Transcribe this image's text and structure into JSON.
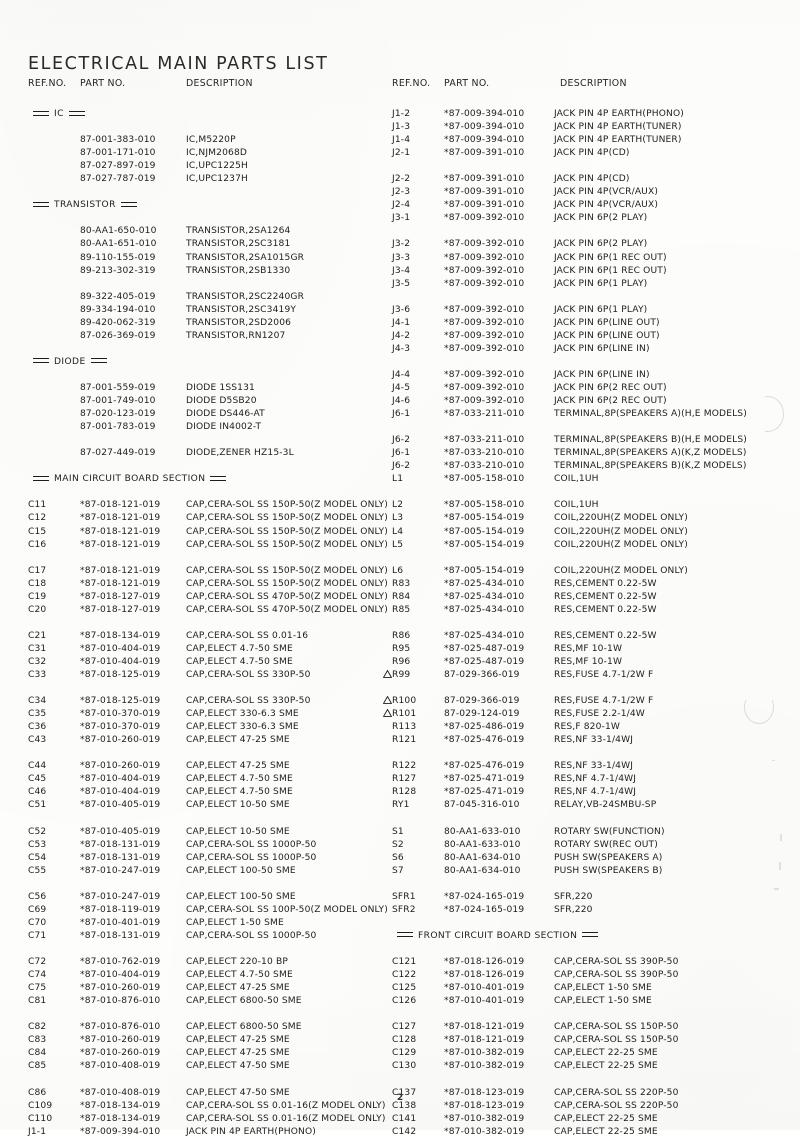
{
  "document": {
    "title": "ELECTRICAL  MAIN  PARTS  LIST",
    "page_number": "2"
  },
  "columns": {
    "ref_no": "REF.NO.",
    "part_no": "PART NO.",
    "description": "DESCRIPTION"
  },
  "sections": {
    "ic": "IC",
    "transistor": "TRANSISTOR",
    "diode": "DIODE",
    "main_circuit_board": "MAIN CIRCUIT BOARD SECTION",
    "front_circuit_board": "FRONT CIRCUIT BOARD SECTION"
  },
  "left_column": [
    {
      "type": "section",
      "label": "IC"
    },
    {
      "type": "blank"
    },
    {
      "type": "item",
      "ref": "",
      "part": "87-001-383-010",
      "desc": "IC,M5220P"
    },
    {
      "type": "item",
      "ref": "",
      "part": "87-001-171-010",
      "desc": "IC,NJM2068D"
    },
    {
      "type": "item",
      "ref": "",
      "part": "87-027-897-019",
      "desc": "IC,UPC1225H"
    },
    {
      "type": "item",
      "ref": "",
      "part": "87-027-787-019",
      "desc": "IC,UPC1237H"
    },
    {
      "type": "blank"
    },
    {
      "type": "section",
      "label": "TRANSISTOR"
    },
    {
      "type": "blank"
    },
    {
      "type": "item",
      "ref": "",
      "part": "80-AA1-650-010",
      "desc": "TRANSISTOR,2SA1264"
    },
    {
      "type": "item",
      "ref": "",
      "part": "80-AA1-651-010",
      "desc": "TRANSISTOR,2SC3181"
    },
    {
      "type": "item",
      "ref": "",
      "part": "89-110-155-019",
      "desc": "TRANSISTOR,2SA1015GR"
    },
    {
      "type": "item",
      "ref": "",
      "part": "89-213-302-319",
      "desc": "TRANSISTOR,2SB1330"
    },
    {
      "type": "blank"
    },
    {
      "type": "item",
      "ref": "",
      "part": "89-322-405-019",
      "desc": "TRANSISTOR,2SC2240GR"
    },
    {
      "type": "item",
      "ref": "",
      "part": "89-334-194-010",
      "desc": "TRANSISTOR,2SC3419Y"
    },
    {
      "type": "item",
      "ref": "",
      "part": "89-420-062-319",
      "desc": "TRANSISTOR,2SD2006"
    },
    {
      "type": "item",
      "ref": "",
      "part": "87-026-369-019",
      "desc": "TRANSISTOR,RN1207"
    },
    {
      "type": "blank"
    },
    {
      "type": "section",
      "label": "DIODE"
    },
    {
      "type": "blank"
    },
    {
      "type": "item",
      "ref": "",
      "part": "87-001-559-019",
      "desc": "DIODE 1SS131"
    },
    {
      "type": "item",
      "ref": "",
      "part": "87-001-749-010",
      "desc": "DIODE D5SB20"
    },
    {
      "type": "item",
      "ref": "",
      "part": "87-020-123-019",
      "desc": "DIODE DS446-AT"
    },
    {
      "type": "item",
      "ref": "",
      "part": "87-001-783-019",
      "desc": "DIODE IN4002-T"
    },
    {
      "type": "blank"
    },
    {
      "type": "item",
      "ref": "",
      "part": "87-027-449-019",
      "desc": "DIODE,ZENER HZ15-3L"
    },
    {
      "type": "blank"
    },
    {
      "type": "section",
      "label": "MAIN CIRCUIT BOARD SECTION"
    },
    {
      "type": "blank"
    },
    {
      "type": "item",
      "ref": "C11",
      "part": "*87-018-121-019",
      "desc": "CAP,CERA-SOL SS 150P-50(Z MODEL ONLY)"
    },
    {
      "type": "item",
      "ref": "C12",
      "part": "*87-018-121-019",
      "desc": "CAP,CERA-SOL SS 150P-50(Z MODEL ONLY)"
    },
    {
      "type": "item",
      "ref": "C15",
      "part": "*87-018-121-019",
      "desc": "CAP,CERA-SOL SS 150P-50(Z MODEL ONLY)"
    },
    {
      "type": "item",
      "ref": "C16",
      "part": "*87-018-121-019",
      "desc": "CAP,CERA-SOL SS 150P-50(Z MODEL ONLY)"
    },
    {
      "type": "blank"
    },
    {
      "type": "item",
      "ref": "C17",
      "part": "*87-018-121-019",
      "desc": "CAP,CERA-SOL SS 150P-50(Z MODEL ONLY)"
    },
    {
      "type": "item",
      "ref": "C18",
      "part": "*87-018-121-019",
      "desc": "CAP,CERA-SOL SS 150P-50(Z MODEL ONLY)"
    },
    {
      "type": "item",
      "ref": "C19",
      "part": "*87-018-127-019",
      "desc": "CAP,CERA-SOL SS 470P-50(Z MODEL ONLY)"
    },
    {
      "type": "item",
      "ref": "C20",
      "part": "*87-018-127-019",
      "desc": "CAP,CERA-SOL SS 470P-50(Z MODEL ONLY)"
    },
    {
      "type": "blank"
    },
    {
      "type": "item",
      "ref": "C21",
      "part": "*87-018-134-019",
      "desc": "CAP,CERA-SOL SS 0.01-16"
    },
    {
      "type": "item",
      "ref": "C31",
      "part": "*87-010-404-019",
      "desc": "CAP,ELECT 4.7-50 SME"
    },
    {
      "type": "item",
      "ref": "C32",
      "part": "*87-010-404-019",
      "desc": "CAP,ELECT 4.7-50 SME"
    },
    {
      "type": "item",
      "ref": "C33",
      "part": "*87-018-125-019",
      "desc": "CAP,CERA-SOL SS 330P-50"
    },
    {
      "type": "blank"
    },
    {
      "type": "item",
      "ref": "C34",
      "part": "*87-018-125-019",
      "desc": "CAP,CERA-SOL SS 330P-50"
    },
    {
      "type": "item",
      "ref": "C35",
      "part": "*87-010-370-019",
      "desc": "CAP,ELECT 330-6.3 SME"
    },
    {
      "type": "item",
      "ref": "C36",
      "part": "*87-010-370-019",
      "desc": "CAP,ELECT 330-6.3 SME"
    },
    {
      "type": "item",
      "ref": "C43",
      "part": "*87-010-260-019",
      "desc": "CAP,ELECT 47-25 SME"
    },
    {
      "type": "blank"
    },
    {
      "type": "item",
      "ref": "C44",
      "part": "*87-010-260-019",
      "desc": "CAP,ELECT 47-25 SME"
    },
    {
      "type": "item",
      "ref": "C45",
      "part": "*87-010-404-019",
      "desc": "CAP,ELECT 4.7-50 SME"
    },
    {
      "type": "item",
      "ref": "C46",
      "part": "*87-010-404-019",
      "desc": "CAP,ELECT 4.7-50 SME"
    },
    {
      "type": "item",
      "ref": "C51",
      "part": "*87-010-405-019",
      "desc": "CAP,ELECT 10-50 SME"
    },
    {
      "type": "blank"
    },
    {
      "type": "item",
      "ref": "C52",
      "part": "*87-010-405-019",
      "desc": "CAP,ELECT 10-50 SME"
    },
    {
      "type": "item",
      "ref": "C53",
      "part": "*87-018-131-019",
      "desc": "CAP,CERA-SOL SS 1000P-50"
    },
    {
      "type": "item",
      "ref": "C54",
      "part": "*87-018-131-019",
      "desc": "CAP,CERA-SOL SS 1000P-50"
    },
    {
      "type": "item",
      "ref": "C55",
      "part": "*87-010-247-019",
      "desc": "CAP,ELECT 100-50 SME"
    },
    {
      "type": "blank"
    },
    {
      "type": "item",
      "ref": "C56",
      "part": "*87-010-247-019",
      "desc": "CAP,ELECT 100-50 SME"
    },
    {
      "type": "item",
      "ref": "C69",
      "part": "*87-018-119-019",
      "desc": "CAP,CERA-SOL SS 100P-50(Z MODEL ONLY)"
    },
    {
      "type": "item",
      "ref": "C70",
      "part": "*87-010-401-019",
      "desc": "CAP,ELECT 1-50 SME"
    },
    {
      "type": "item",
      "ref": "C71",
      "part": "*87-018-131-019",
      "desc": "CAP,CERA-SOL SS 1000P-50"
    },
    {
      "type": "blank"
    },
    {
      "type": "item",
      "ref": "C72",
      "part": "*87-010-762-019",
      "desc": "CAP,ELECT 220-10 BP"
    },
    {
      "type": "item",
      "ref": "C74",
      "part": "*87-010-404-019",
      "desc": "CAP,ELECT 4.7-50 SME"
    },
    {
      "type": "item",
      "ref": "C75",
      "part": "*87-010-260-019",
      "desc": "CAP,ELECT 47-25 SME"
    },
    {
      "type": "item",
      "ref": "C81",
      "part": "*87-010-876-010",
      "desc": "CAP,ELECT 6800-50 SME"
    },
    {
      "type": "blank"
    },
    {
      "type": "item",
      "ref": "C82",
      "part": "*87-010-876-010",
      "desc": "CAP,ELECT 6800-50 SME"
    },
    {
      "type": "item",
      "ref": "C83",
      "part": "*87-010-260-019",
      "desc": "CAP,ELECT 47-25 SME"
    },
    {
      "type": "item",
      "ref": "C84",
      "part": "*87-010-260-019",
      "desc": "CAP,ELECT 47-25 SME"
    },
    {
      "type": "item",
      "ref": "C85",
      "part": "*87-010-408-019",
      "desc": "CAP,ELECT 47-50 SME"
    },
    {
      "type": "blank"
    },
    {
      "type": "item",
      "ref": "C86",
      "part": "*87-010-408-019",
      "desc": "CAP,ELECT 47-50 SME"
    },
    {
      "type": "item",
      "ref": "C109",
      "part": "*87-018-134-019",
      "desc": "CAP,CERA-SOL SS 0.01-16(Z MODEL ONLY)"
    },
    {
      "type": "item",
      "ref": "C110",
      "part": "*87-018-134-019",
      "desc": "CAP,CERA-SOL SS 0.01-16(Z MODEL ONLY)"
    },
    {
      "type": "item",
      "ref": "J1-1",
      "part": "*87-009-394-010",
      "desc": "JACK PIN 4P EARTH(PHONO)"
    }
  ],
  "right_column": [
    {
      "type": "item",
      "ref": "J1-2",
      "part": "*87-009-394-010",
      "desc": "JACK PIN 4P EARTH(PHONO)"
    },
    {
      "type": "item",
      "ref": "J1-3",
      "part": "*87-009-394-010",
      "desc": "JACK PIN 4P EARTH(TUNER)"
    },
    {
      "type": "item",
      "ref": "J1-4",
      "part": "*87-009-394-010",
      "desc": "JACK PIN 4P EARTH(TUNER)"
    },
    {
      "type": "item",
      "ref": "J2-1",
      "part": "*87-009-391-010",
      "desc": "JACK PIN 4P(CD)"
    },
    {
      "type": "blank"
    },
    {
      "type": "item",
      "ref": "J2-2",
      "part": "*87-009-391-010",
      "desc": "JACK PIN 4P(CD)"
    },
    {
      "type": "item",
      "ref": "J2-3",
      "part": "*87-009-391-010",
      "desc": "JACK PIN 4P(VCR/AUX)"
    },
    {
      "type": "item",
      "ref": "J2-4",
      "part": "*87-009-391-010",
      "desc": "JACK PIN 4P(VCR/AUX)"
    },
    {
      "type": "item",
      "ref": "J3-1",
      "part": "*87-009-392-010",
      "desc": "JACK PIN 6P(2 PLAY)"
    },
    {
      "type": "blank"
    },
    {
      "type": "item",
      "ref": "J3-2",
      "part": "*87-009-392-010",
      "desc": "JACK PIN 6P(2 PLAY)"
    },
    {
      "type": "item",
      "ref": "J3-3",
      "part": "*87-009-392-010",
      "desc": "JACK PIN 6P(1 REC OUT)"
    },
    {
      "type": "item",
      "ref": "J3-4",
      "part": "*87-009-392-010",
      "desc": "JACK PIN 6P(1 REC OUT)"
    },
    {
      "type": "item",
      "ref": "J3-5",
      "part": "*87-009-392-010",
      "desc": "JACK PIN 6P(1 PLAY)"
    },
    {
      "type": "blank"
    },
    {
      "type": "item",
      "ref": "J3-6",
      "part": "*87-009-392-010",
      "desc": "JACK PIN 6P(1 PLAY)"
    },
    {
      "type": "item",
      "ref": "J4-1",
      "part": "*87-009-392-010",
      "desc": "JACK PIN 6P(LINE OUT)"
    },
    {
      "type": "item",
      "ref": "J4-2",
      "part": "*87-009-392-010",
      "desc": "JACK PIN 6P(LINE OUT)"
    },
    {
      "type": "item",
      "ref": "J4-3",
      "part": "*87-009-392-010",
      "desc": "JACK PIN 6P(LINE IN)"
    },
    {
      "type": "blank"
    },
    {
      "type": "item",
      "ref": "J4-4",
      "part": "*87-009-392-010",
      "desc": "JACK PIN 6P(LINE IN)"
    },
    {
      "type": "item",
      "ref": "J4-5",
      "part": "*87-009-392-010",
      "desc": "JACK PIN 6P(2 REC OUT)"
    },
    {
      "type": "item",
      "ref": "J4-6",
      "part": "*87-009-392-010",
      "desc": "JACK PIN 6P(2 REC OUT)"
    },
    {
      "type": "item",
      "ref": "J6-1",
      "part": "*87-033-211-010",
      "desc": "TERMINAL,8P(SPEAKERS A)(H,E MODELS)"
    },
    {
      "type": "blank"
    },
    {
      "type": "item",
      "ref": "J6-2",
      "part": "*87-033-211-010",
      "desc": "TERMINAL,8P(SPEAKERS B)(H,E MODELS)"
    },
    {
      "type": "item",
      "ref": "J6-1",
      "part": "*87-033-210-010",
      "desc": "TERMINAL,8P(SPEAKERS A)(K,Z MODELS)"
    },
    {
      "type": "item",
      "ref": "J6-2",
      "part": "*87-033-210-010",
      "desc": "TERMINAL,8P(SPEAKERS B)(K,Z MODELS)"
    },
    {
      "type": "item",
      "ref": "L1",
      "part": "*87-005-158-010",
      "desc": "COIL,1UH"
    },
    {
      "type": "blank"
    },
    {
      "type": "item",
      "ref": "L2",
      "part": "*87-005-158-010",
      "desc": "COIL,1UH"
    },
    {
      "type": "item",
      "ref": "L3",
      "part": "*87-005-154-019",
      "desc": "COIL,220UH(Z MODEL ONLY)"
    },
    {
      "type": "item",
      "ref": "L4",
      "part": "*87-005-154-019",
      "desc": "COIL,220UH(Z MODEL ONLY)"
    },
    {
      "type": "item",
      "ref": "L5",
      "part": "*87-005-154-019",
      "desc": "COIL,220UH(Z MODEL ONLY)"
    },
    {
      "type": "blank"
    },
    {
      "type": "item",
      "ref": "L6",
      "part": "*87-005-154-019",
      "desc": "COIL,220UH(Z MODEL ONLY)"
    },
    {
      "type": "item",
      "ref": "R83",
      "part": "*87-025-434-010",
      "desc": "RES,CEMENT 0.22-5W"
    },
    {
      "type": "item",
      "ref": "R84",
      "part": "*87-025-434-010",
      "desc": "RES,CEMENT 0.22-5W"
    },
    {
      "type": "item",
      "ref": "R85",
      "part": "*87-025-434-010",
      "desc": "RES,CEMENT 0.22-5W"
    },
    {
      "type": "blank"
    },
    {
      "type": "item",
      "ref": "R86",
      "part": "*87-025-434-010",
      "desc": "RES,CEMENT 0.22-5W"
    },
    {
      "type": "item",
      "ref": "R95",
      "part": "*87-025-487-019",
      "desc": "RES,MF 10-1W"
    },
    {
      "type": "item",
      "ref": "R96",
      "part": "*87-025-487-019",
      "desc": "RES,MF 10-1W"
    },
    {
      "type": "item",
      "ref": "R99",
      "part": "87-029-366-019",
      "desc": "RES,FUSE 4.7-1/2W F",
      "warning": true
    },
    {
      "type": "blank"
    },
    {
      "type": "item",
      "ref": "R100",
      "part": "87-029-366-019",
      "desc": "RES,FUSE 4.7-1/2W F",
      "warning": true
    },
    {
      "type": "item",
      "ref": "R101",
      "part": "87-029-124-019",
      "desc": "RES,FUSE 2.2-1/4W",
      "warning": true
    },
    {
      "type": "item",
      "ref": "R113",
      "part": "*87-025-486-019",
      "desc": "RES,F 820-1W"
    },
    {
      "type": "item",
      "ref": "R121",
      "part": "*87-025-476-019",
      "desc": "RES,NF 33-1/4WJ"
    },
    {
      "type": "blank"
    },
    {
      "type": "item",
      "ref": "R122",
      "part": "*87-025-476-019",
      "desc": "RES,NF 33-1/4WJ"
    },
    {
      "type": "item",
      "ref": "R127",
      "part": "*87-025-471-019",
      "desc": "RES,NF 4.7-1/4WJ"
    },
    {
      "type": "item",
      "ref": "R128",
      "part": "*87-025-471-019",
      "desc": "RES,NF 4.7-1/4WJ"
    },
    {
      "type": "item",
      "ref": "RY1",
      "part": "87-045-316-010",
      "desc": "RELAY,VB-24SMBU-SP"
    },
    {
      "type": "blank"
    },
    {
      "type": "item",
      "ref": "S1",
      "part": "80-AA1-633-010",
      "desc": "ROTARY SW(FUNCTION)"
    },
    {
      "type": "item",
      "ref": "S2",
      "part": "80-AA1-633-010",
      "desc": "ROTARY SW(REC OUT)"
    },
    {
      "type": "item",
      "ref": "S6",
      "part": "80-AA1-634-010",
      "desc": "PUSH SW(SPEAKERS A)"
    },
    {
      "type": "item",
      "ref": "S7",
      "part": "80-AA1-634-010",
      "desc": "PUSH SW(SPEAKERS B)"
    },
    {
      "type": "blank"
    },
    {
      "type": "item",
      "ref": "SFR1",
      "part": "*87-024-165-019",
      "desc": "SFR,220"
    },
    {
      "type": "item",
      "ref": "SFR2",
      "part": "*87-024-165-019",
      "desc": "SFR,220"
    },
    {
      "type": "blank"
    },
    {
      "type": "section",
      "label": "FRONT CIRCUIT BOARD SECTION"
    },
    {
      "type": "blank"
    },
    {
      "type": "item",
      "ref": "C121",
      "part": "*87-018-126-019",
      "desc": "CAP,CERA-SOL SS 390P-50"
    },
    {
      "type": "item",
      "ref": "C122",
      "part": "*87-018-126-019",
      "desc": "CAP,CERA-SOL SS 390P-50"
    },
    {
      "type": "item",
      "ref": "C125",
      "part": "*87-010-401-019",
      "desc": "CAP,ELECT 1-50 SME"
    },
    {
      "type": "item",
      "ref": "C126",
      "part": "*87-010-401-019",
      "desc": "CAP,ELECT 1-50 SME"
    },
    {
      "type": "blank"
    },
    {
      "type": "item",
      "ref": "C127",
      "part": "*87-018-121-019",
      "desc": "CAP,CERA-SOL SS 150P-50"
    },
    {
      "type": "item",
      "ref": "C128",
      "part": "*87-018-121-019",
      "desc": "CAP,CERA-SOL SS 150P-50"
    },
    {
      "type": "item",
      "ref": "C129",
      "part": "*87-010-382-019",
      "desc": "CAP,ELECT 22-25 SME"
    },
    {
      "type": "item",
      "ref": "C130",
      "part": "*87-010-382-019",
      "desc": "CAP,ELECT 22-25 SME"
    },
    {
      "type": "blank"
    },
    {
      "type": "item",
      "ref": "C137",
      "part": "*87-018-123-019",
      "desc": "CAP,CERA-SOL SS 220P-50"
    },
    {
      "type": "item",
      "ref": "C138",
      "part": "*87-018-123-019",
      "desc": "CAP,CERA-SOL SS 220P-50"
    },
    {
      "type": "item",
      "ref": "C141",
      "part": "*87-010-382-019",
      "desc": "CAP,ELECT 22-25 SME"
    },
    {
      "type": "item",
      "ref": "C142",
      "part": "*87-010-382-019",
      "desc": "CAP,ELECT 22-25 SME"
    }
  ]
}
